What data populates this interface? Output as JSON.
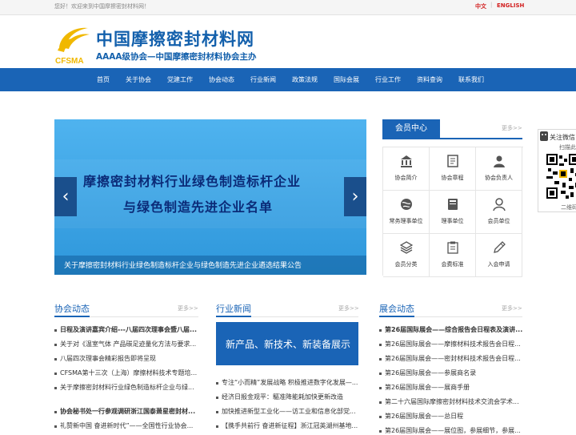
{
  "topbar": {
    "welcome": "您好！欢迎来到中国摩擦密封材料网！",
    "lang_cn": "中文",
    "separator": "|",
    "lang_en": "ENGLISH"
  },
  "header": {
    "logo_text": "CFSMA",
    "title": "中国摩擦密封材料网",
    "subtitle": "AAAA级协会—中国摩擦密封材料协会主办"
  },
  "nav": {
    "items": [
      "首页",
      "关于协会",
      "党建工作",
      "协会动态",
      "行业新闻",
      "政策法规",
      "国际会展",
      "行业工作",
      "资料查询",
      "联系我们"
    ]
  },
  "banner": {
    "line1": "摩擦密封材料行业绿色制造标杆企业",
    "line2": "与绿色制造先进企业名单",
    "caption": "关于摩擦密封材料行业绿色制造标杆企业与绿色制造先进企业遴选结果公告",
    "prev": "‹",
    "next": "›"
  },
  "member": {
    "title": "会员中心",
    "more": "更多>>",
    "cells": [
      {
        "label": "协会简介",
        "icon": "building-icon"
      },
      {
        "label": "协会章程",
        "icon": "document-icon"
      },
      {
        "label": "协会负责人",
        "icon": "person-icon"
      },
      {
        "label": "常务理事单位",
        "icon": "globe-icon"
      },
      {
        "label": "理事单位",
        "icon": "book-icon"
      },
      {
        "label": "会员单位",
        "icon": "user-icon"
      },
      {
        "label": "会员分类",
        "icon": "layers-icon"
      },
      {
        "label": "会费标准",
        "icon": "clipboard-icon"
      },
      {
        "label": "入会申请",
        "icon": "pencil-icon"
      }
    ]
  },
  "wechat": {
    "title": "关注微信",
    "scan": "扫描此",
    "qrcode": "二维码"
  },
  "sections": {
    "association": {
      "title": "协会动态",
      "more": "更多>>",
      "group1": [
        "日程及演讲嘉宾介绍---八届四次理事会暨八届...",
        "关于对《温室气体 产品碳足迹量化方法与要求...",
        "八届四次理事会精彩报告即将呈现",
        "CFSMA第十三次（上海）摩擦材料技术专题培...",
        "关于摩擦密封材料行业绿色制造标杆企业与绿..."
      ],
      "group2": [
        "协会秘书处一行参观调研浙江国泰萧星密封材...",
        "礼赞新中国 奋进新时代”——全国性行业协会..."
      ]
    },
    "industry": {
      "title": "行业新闻",
      "more": "更多>>",
      "promo": "新产品、新技术、新装备展示",
      "items": [
        "专注“小而精”发展战略 积极推进数字化发展—...",
        "经济日报金观平：驅准降能耗加快更新改造",
        "加快推进新型工业化——访工业和信息化部党...",
        "【携手共前行 奋进新征程】浙江冠英湖州基地..."
      ]
    },
    "exhibition": {
      "title": "展会动态",
      "more": "更多>>",
      "items": [
        "第26届国际展会——综合报告会日程表及演讲...",
        "第26届国际展会——摩擦材料技术报告会日程...",
        "第26届国际展会——密封材料技术报告会日程...",
        "第26届国际展会——参展商名录",
        "第26届国际展会——展商手册",
        "第二十六届国际摩擦密封材料技术交流会学术...",
        "第26届国际展会——总日程",
        "第26届国际展会——展位图，参展细节，参展..."
      ]
    }
  },
  "colors": {
    "brand_blue": "#1a64b6",
    "logo_yellow": "#f0b800",
    "accent_red": "#d21f1f",
    "banner_blue": "#36a3e4",
    "banner_text": "#0b2b78"
  }
}
